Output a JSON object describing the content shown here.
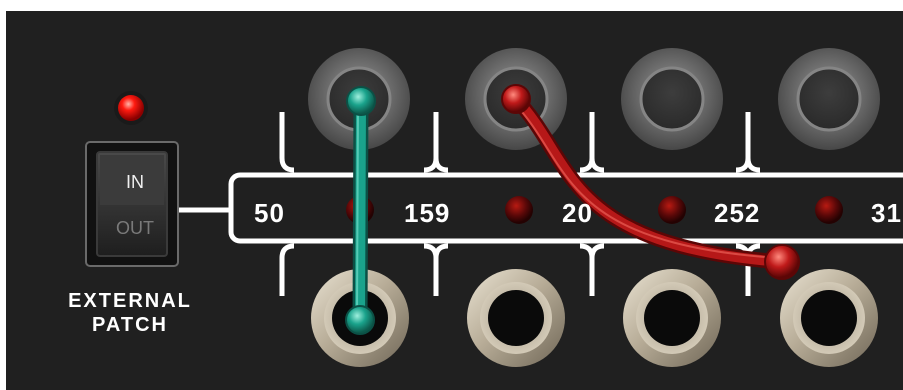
{
  "panel": {
    "external_patch": {
      "line1": "EXTERNAL",
      "line2": "PATCH"
    },
    "switch": {
      "on_label": "IN",
      "off_label": "OUT",
      "state": "IN"
    },
    "status_led": "on",
    "frequencies": [
      "50",
      "159",
      "20",
      "252",
      "31"
    ]
  },
  "colors": {
    "panel_bg": "#202020",
    "rail": "#ffffff",
    "led_on": "#ff1a10",
    "led_off": "#5a0808",
    "cable_teal": "#1aa38c",
    "cable_red": "#b61818"
  },
  "cables": [
    {
      "color": "teal",
      "from": "top-jack-1",
      "to": "bottom-jack-1"
    },
    {
      "color": "red",
      "from": "top-jack-2",
      "to": "bottom-jack-4"
    }
  ]
}
